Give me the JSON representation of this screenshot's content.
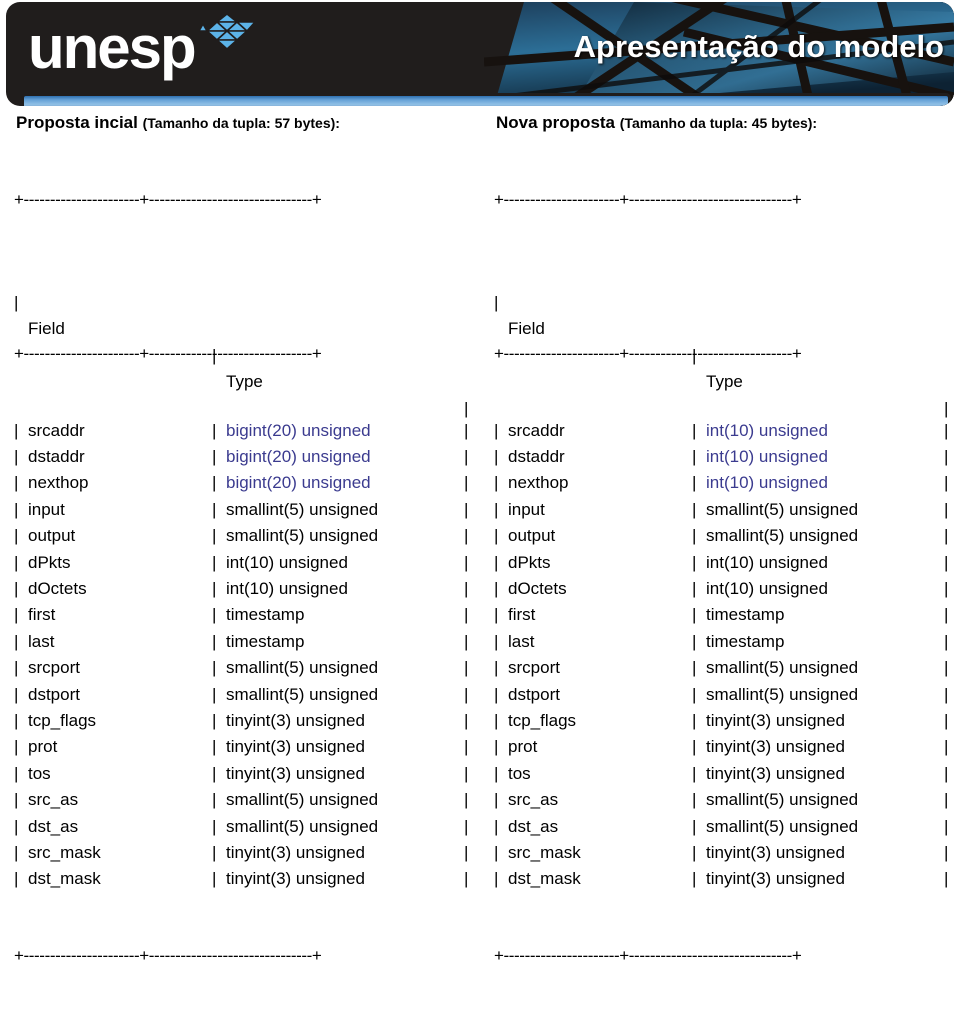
{
  "header": {
    "logo_word": "unesp",
    "logo_mark_icon": "unesp-hex-logo-icon",
    "title": "Apresentação do modelo"
  },
  "panels": [
    {
      "id": "proposta-inicial",
      "title_strong": "Proposta incial",
      "title_paren": "(Tamanho da tupla: 57 bytes):",
      "tuple_size_bytes": 57,
      "rule": "+----------------------+-------------------------------+",
      "columns": [
        "Field",
        "Type"
      ],
      "rows": [
        {
          "field": "srcaddr",
          "type": "bigint(20) unsigned",
          "type_color": "blue"
        },
        {
          "field": "dstaddr",
          "type": "bigint(20) unsigned",
          "type_color": "blue"
        },
        {
          "field": "nexthop",
          "type": "bigint(20) unsigned",
          "type_color": "blue"
        },
        {
          "field": "input",
          "type": "smallint(5) unsigned",
          "type_color": "black"
        },
        {
          "field": "output",
          "type": "smallint(5) unsigned",
          "type_color": "black"
        },
        {
          "field": "dPkts",
          "type": "int(10) unsigned",
          "type_color": "black"
        },
        {
          "field": "dOctets",
          "type": "int(10) unsigned",
          "type_color": "black"
        },
        {
          "field": "first",
          "type": "timestamp",
          "type_color": "black"
        },
        {
          "field": "last",
          "type": "timestamp",
          "type_color": "black"
        },
        {
          "field": "srcport",
          "type": "smallint(5) unsigned",
          "type_color": "black"
        },
        {
          "field": "dstport",
          "type": "smallint(5) unsigned",
          "type_color": "black"
        },
        {
          "field": "tcp_flags",
          "type": "tinyint(3) unsigned",
          "type_color": "black"
        },
        {
          "field": "prot",
          "type": "tinyint(3) unsigned",
          "type_color": "black"
        },
        {
          "field": "tos",
          "type": "tinyint(3) unsigned",
          "type_color": "black"
        },
        {
          "field": "src_as",
          "type": "smallint(5) unsigned",
          "type_color": "black"
        },
        {
          "field": "dst_as",
          "type": "smallint(5) unsigned",
          "type_color": "black"
        },
        {
          "field": "src_mask",
          "type": "tinyint(3) unsigned",
          "type_color": "black"
        },
        {
          "field": "dst_mask",
          "type": "tinyint(3) unsigned",
          "type_color": "black"
        }
      ]
    },
    {
      "id": "nova-proposta",
      "title_strong": "Nova proposta",
      "title_paren": "(Tamanho da tupla: 45 bytes):",
      "tuple_size_bytes": 45,
      "rule": "+----------------------+-------------------------------+",
      "columns": [
        "Field",
        "Type"
      ],
      "rows": [
        {
          "field": "srcaddr",
          "type": "int(10) unsigned",
          "type_color": "blue"
        },
        {
          "field": "dstaddr",
          "type": "int(10) unsigned",
          "type_color": "blue"
        },
        {
          "field": "nexthop",
          "type": "int(10) unsigned",
          "type_color": "blue"
        },
        {
          "field": "input",
          "type": "smallint(5) unsigned",
          "type_color": "black"
        },
        {
          "field": "output",
          "type": "smallint(5) unsigned",
          "type_color": "black"
        },
        {
          "field": "dPkts",
          "type": "int(10) unsigned",
          "type_color": "black"
        },
        {
          "field": "dOctets",
          "type": "int(10) unsigned",
          "type_color": "black"
        },
        {
          "field": "first",
          "type": "timestamp",
          "type_color": "black"
        },
        {
          "field": "last",
          "type": "timestamp",
          "type_color": "black"
        },
        {
          "field": "srcport",
          "type": "smallint(5) unsigned",
          "type_color": "black"
        },
        {
          "field": "dstport",
          "type": "smallint(5) unsigned",
          "type_color": "black"
        },
        {
          "field": "tcp_flags",
          "type": "tinyint(3) unsigned",
          "type_color": "black"
        },
        {
          "field": "prot",
          "type": "tinyint(3) unsigned",
          "type_color": "black"
        },
        {
          "field": "tos",
          "type": "tinyint(3) unsigned",
          "type_color": "black"
        },
        {
          "field": "src_as",
          "type": "smallint(5) unsigned",
          "type_color": "black"
        },
        {
          "field": "dst_as",
          "type": "smallint(5) unsigned",
          "type_color": "black"
        },
        {
          "field": "src_mask",
          "type": "tinyint(3) unsigned",
          "type_color": "black"
        },
        {
          "field": "dst_mask",
          "type": "tinyint(3) unsigned",
          "type_color": "black"
        }
      ]
    }
  ],
  "glyphs": {
    "bar": "|"
  },
  "colors": {
    "type_highlight": "#3b3b8f",
    "text": "#000000",
    "banner_bg": "#201d1c",
    "logo_mark": "#5cb3e8",
    "strip_top": "#8fc0e6",
    "strip_bottom": "#4a4a78"
  }
}
